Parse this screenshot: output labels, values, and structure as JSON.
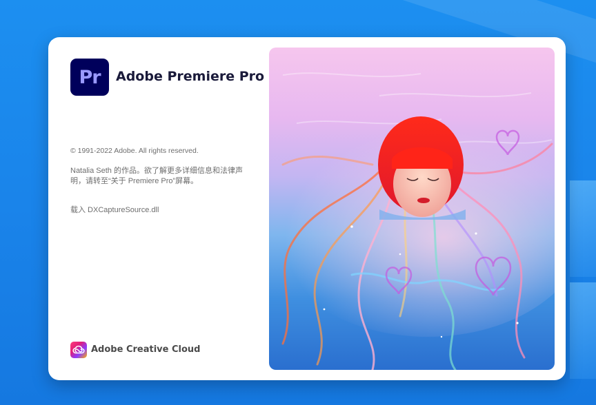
{
  "splash": {
    "app_icon_text": "Pr",
    "app_title": "Adobe Premiere Pro",
    "copyright": "© 1991-2022 Adobe. All rights reserved.",
    "credits": "Natalia  Seth 的作品。欲了解更多详细信息和法律声明，请转至“关于 Premiere Pro”屏幕。",
    "loading": "载入  DXCaptureSource.dll",
    "footer_brand": "Adobe Creative Cloud"
  },
  "colors": {
    "app_icon_bg": "#00005b",
    "app_icon_fg": "#9999ff",
    "desktop_bg": "#1a84ea",
    "hair": "#e8231a",
    "water": "#5aa8e8"
  },
  "icons": {
    "app_icon": "premiere-pro-icon",
    "footer_icon": "creative-cloud-icon"
  }
}
